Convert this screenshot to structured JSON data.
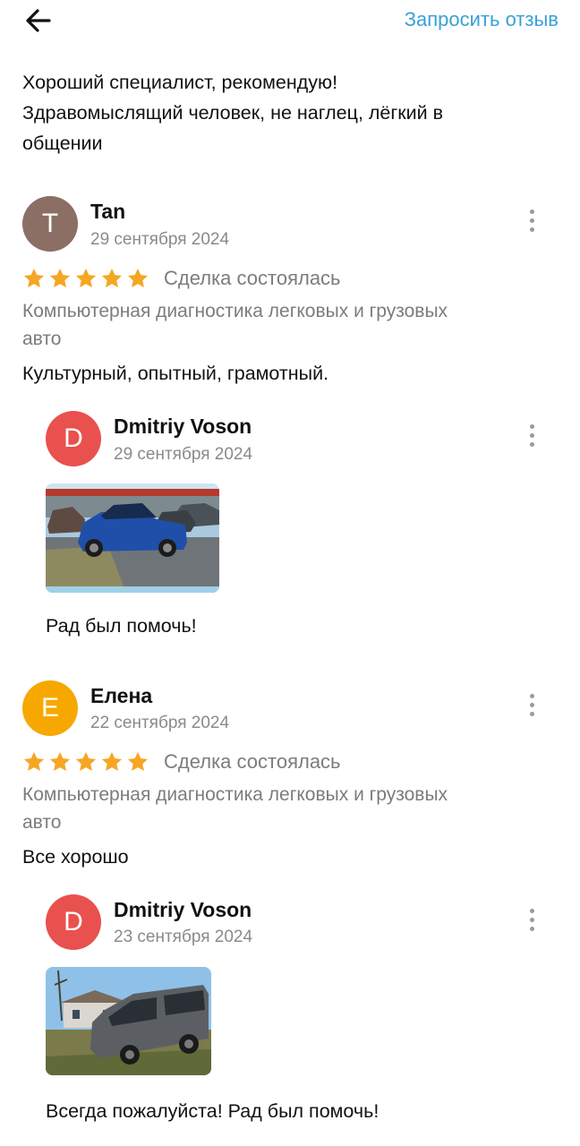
{
  "header": {
    "request_review_label": "Запросить отзыв"
  },
  "intro_text": [
    "Хороший специалист, рекомендую!",
    "Здравомыслящий человек, не наглец, лёгкий в",
    "общении"
  ],
  "reviews": [
    {
      "avatar_letter": "T",
      "avatar_color": "#8b6e64",
      "author": "Tan",
      "date": "29 сентября 2024",
      "rating": 5,
      "deal_status": "Сделка состоялась",
      "service": [
        "Компьютерная диагностика легковых и грузовых",
        "авто"
      ],
      "text": "Культурный, опытный, грамотный.",
      "reply": {
        "avatar_letter": "D",
        "avatar_color": "#e9514e",
        "author": "Dmitriy Voson",
        "date": "29 сентября 2024",
        "text": "Рад был помочь!"
      }
    },
    {
      "avatar_letter": "E",
      "avatar_color": "#f7a800",
      "author": "Елена",
      "date": "22 сентября 2024",
      "rating": 5,
      "deal_status": "Сделка состоялась",
      "service": [
        "Компьютерная диагностика легковых и грузовых",
        "авто"
      ],
      "text": "Все хорошо",
      "reply": {
        "avatar_letter": "D",
        "avatar_color": "#e9514e",
        "author": "Dmitriy Voson",
        "date": "23 сентября 2024",
        "text": "Всегда пожалуйста! Рад был помочь!"
      }
    }
  ],
  "colors": {
    "star": "#f5a623",
    "link": "#3aa0d8",
    "muted": "#7c7c7c"
  },
  "icons": [
    "back-arrow-icon",
    "more-vert-icon",
    "star-icon"
  ]
}
